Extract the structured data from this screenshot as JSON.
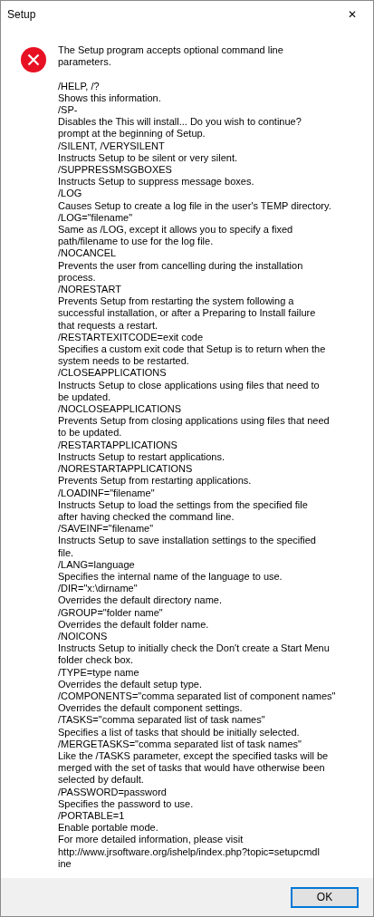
{
  "window": {
    "title": "Setup",
    "close": "✕"
  },
  "message": {
    "kind": "error",
    "intro": [
      "The Setup program accepts optional command line",
      "parameters."
    ],
    "lines": [
      "/HELP, /?",
      "Shows this information.",
      "/SP-",
      "Disables the This will install... Do you wish to continue?",
      "prompt at the beginning of Setup.",
      "/SILENT, /VERYSILENT",
      "Instructs Setup to be silent or very silent.",
      "/SUPPRESSMSGBOXES",
      "Instructs Setup to suppress message boxes.",
      "/LOG",
      "Causes Setup to create a log file in the user's TEMP directory.",
      "/LOG=\"filename\"",
      "Same as /LOG, except it allows you to specify a fixed",
      "path/filename to use for the log file.",
      "/NOCANCEL",
      "Prevents the user from cancelling during the installation",
      "process.",
      "/NORESTART",
      "Prevents Setup from restarting the system following a",
      "successful installation, or after a Preparing to Install failure",
      "that requests a restart.",
      "/RESTARTEXITCODE=exit code",
      "Specifies a custom exit code that Setup is to return when the",
      "system needs to be restarted.",
      "/CLOSEAPPLICATIONS",
      "Instructs Setup to close applications using files that need to",
      "be updated.",
      "/NOCLOSEAPPLICATIONS",
      "Prevents Setup from closing applications using files that need",
      "to be updated.",
      "/RESTARTAPPLICATIONS",
      "Instructs Setup to restart applications.",
      "/NORESTARTAPPLICATIONS",
      "Prevents Setup from restarting applications.",
      "/LOADINF=\"filename\"",
      "Instructs Setup to load the settings from the specified file",
      "after having checked the command line.",
      "/SAVEINF=\"filename\"",
      "Instructs Setup to save installation settings to the specified",
      "file.",
      "/LANG=language",
      "Specifies the internal name of the language to use.",
      "/DIR=\"x:\\dirname\"",
      "Overrides the default directory name.",
      "/GROUP=\"folder name\"",
      "Overrides the default folder name.",
      "/NOICONS",
      "Instructs Setup to initially check the Don't create a Start Menu",
      "folder check box.",
      "/TYPE=type name",
      "Overrides the default setup type.",
      "/COMPONENTS=\"comma separated list of component names\"",
      "Overrides the default component settings.",
      "/TASKS=\"comma separated list of task names\"",
      "Specifies a list of tasks that should be initially selected.",
      "/MERGETASKS=\"comma separated list of task names\"",
      "Like the /TASKS parameter, except the specified tasks will be",
      "merged with the set of tasks that would have otherwise been",
      "selected by default.",
      "/PASSWORD=password",
      "Specifies the password to use.",
      "/PORTABLE=1",
      "Enable portable mode.",
      "For more detailed information, please visit",
      "http://www.jrsoftware.org/ishelp/index.php?topic=setupcmdl",
      "ine"
    ]
  },
  "buttons": [
    {
      "label": "OK",
      "default": true
    }
  ]
}
